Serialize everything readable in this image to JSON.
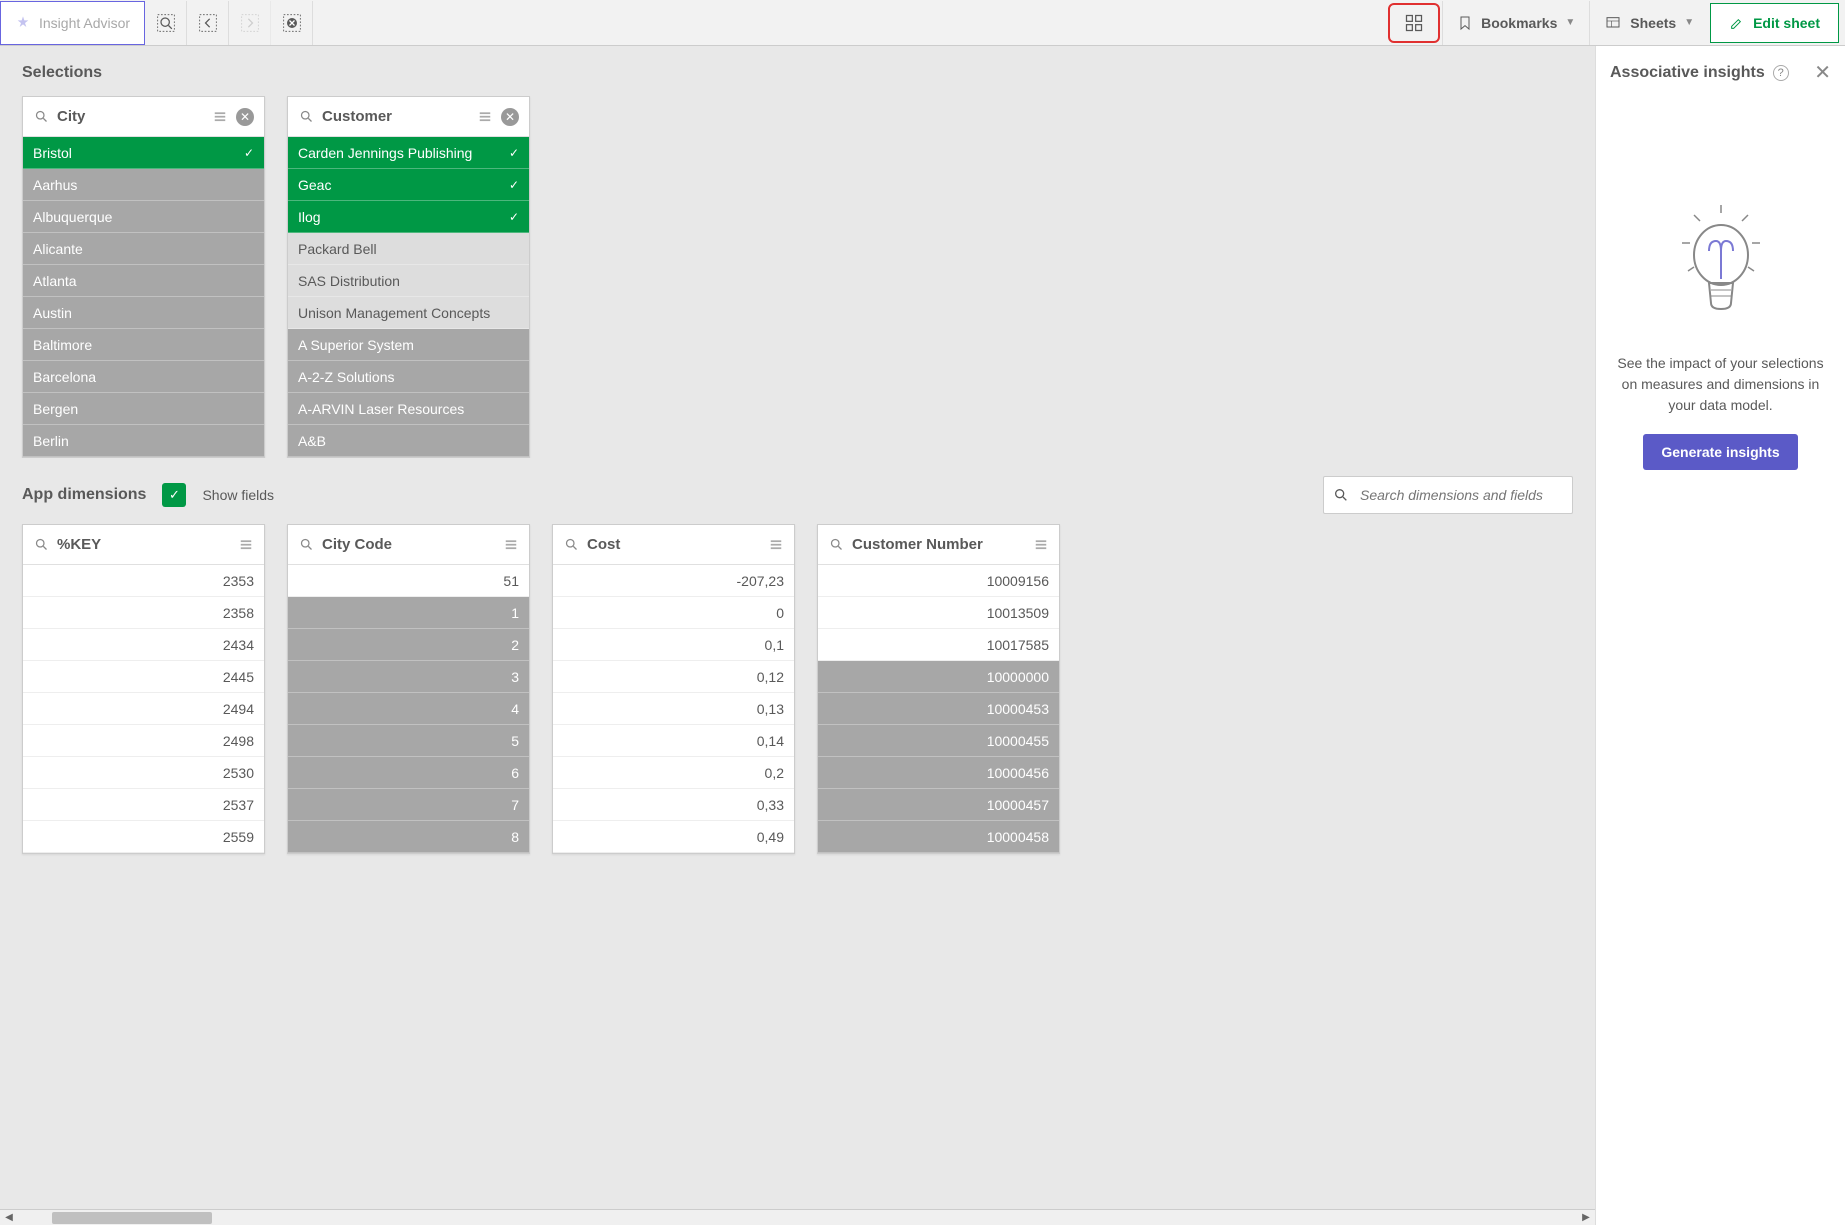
{
  "toolbar": {
    "insight_label": "Insight Advisor",
    "bookmarks_label": "Bookmarks",
    "sheets_label": "Sheets",
    "edit_label": "Edit sheet"
  },
  "selections_title": "Selections",
  "appdim_title": "App dimensions",
  "show_fields_label": "Show fields",
  "search_placeholder": "Search dimensions and fields",
  "right_panel": {
    "title": "Associative insights",
    "desc": "See the impact of your selections on measures and dimensions in your data model.",
    "button": "Generate insights"
  },
  "selection_boxes": [
    {
      "title": "City",
      "has_close": true,
      "items": [
        {
          "label": "Bristol",
          "state": "selected"
        },
        {
          "label": "Aarhus",
          "state": "excluded"
        },
        {
          "label": "Albuquerque",
          "state": "excluded"
        },
        {
          "label": "Alicante",
          "state": "excluded"
        },
        {
          "label": "Atlanta",
          "state": "excluded"
        },
        {
          "label": "Austin",
          "state": "excluded"
        },
        {
          "label": "Baltimore",
          "state": "excluded"
        },
        {
          "label": "Barcelona",
          "state": "excluded"
        },
        {
          "label": "Bergen",
          "state": "excluded"
        },
        {
          "label": "Berlin",
          "state": "excluded"
        }
      ]
    },
    {
      "title": "Customer",
      "has_close": true,
      "items": [
        {
          "label": "Carden Jennings Publishing",
          "state": "selected"
        },
        {
          "label": "Geac",
          "state": "selected"
        },
        {
          "label": "Ilog",
          "state": "selected"
        },
        {
          "label": "Packard Bell",
          "state": "alternative"
        },
        {
          "label": "SAS Distribution",
          "state": "alternative"
        },
        {
          "label": "Unison Management Concepts",
          "state": "alternative"
        },
        {
          "label": "A Superior System",
          "state": "excluded"
        },
        {
          "label": "A-2-Z Solutions",
          "state": "excluded"
        },
        {
          "label": "A-ARVIN Laser Resources",
          "state": "excluded"
        },
        {
          "label": "A&B",
          "state": "excluded"
        }
      ]
    }
  ],
  "dimension_boxes": [
    {
      "title": "%KEY",
      "numeric": true,
      "items": [
        {
          "label": "2353",
          "state": "possible"
        },
        {
          "label": "2358",
          "state": "possible"
        },
        {
          "label": "2434",
          "state": "possible"
        },
        {
          "label": "2445",
          "state": "possible"
        },
        {
          "label": "2494",
          "state": "possible"
        },
        {
          "label": "2498",
          "state": "possible"
        },
        {
          "label": "2530",
          "state": "possible"
        },
        {
          "label": "2537",
          "state": "possible"
        },
        {
          "label": "2559",
          "state": "possible"
        }
      ]
    },
    {
      "title": "City Code",
      "numeric": true,
      "items": [
        {
          "label": "51",
          "state": "possible"
        },
        {
          "label": "1",
          "state": "excluded"
        },
        {
          "label": "2",
          "state": "excluded"
        },
        {
          "label": "3",
          "state": "excluded"
        },
        {
          "label": "4",
          "state": "excluded"
        },
        {
          "label": "5",
          "state": "excluded"
        },
        {
          "label": "6",
          "state": "excluded"
        },
        {
          "label": "7",
          "state": "excluded"
        },
        {
          "label": "8",
          "state": "excluded"
        }
      ]
    },
    {
      "title": "Cost",
      "numeric": true,
      "items": [
        {
          "label": "-207,23",
          "state": "possible"
        },
        {
          "label": "0",
          "state": "possible"
        },
        {
          "label": "0,1",
          "state": "possible"
        },
        {
          "label": "0,12",
          "state": "possible"
        },
        {
          "label": "0,13",
          "state": "possible"
        },
        {
          "label": "0,14",
          "state": "possible"
        },
        {
          "label": "0,2",
          "state": "possible"
        },
        {
          "label": "0,33",
          "state": "possible"
        },
        {
          "label": "0,49",
          "state": "possible"
        }
      ]
    },
    {
      "title": "Customer Number",
      "numeric": true,
      "items": [
        {
          "label": "10009156",
          "state": "possible"
        },
        {
          "label": "10013509",
          "state": "possible"
        },
        {
          "label": "10017585",
          "state": "possible"
        },
        {
          "label": "10000000",
          "state": "excluded"
        },
        {
          "label": "10000453",
          "state": "excluded"
        },
        {
          "label": "10000455",
          "state": "excluded"
        },
        {
          "label": "10000456",
          "state": "excluded"
        },
        {
          "label": "10000457",
          "state": "excluded"
        },
        {
          "label": "10000458",
          "state": "excluded"
        }
      ]
    }
  ]
}
